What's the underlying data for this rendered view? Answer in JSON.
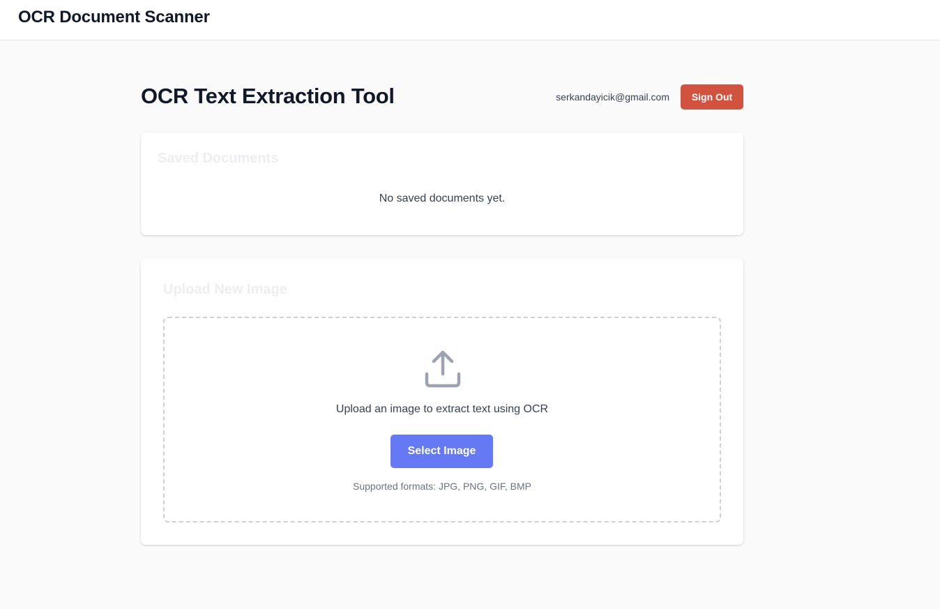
{
  "app": {
    "title": "OCR Document Scanner"
  },
  "header": {
    "title": "OCR Text Extraction Tool",
    "user_email": "serkandayicik@gmail.com",
    "sign_out_label": "Sign Out"
  },
  "saved_documents": {
    "title": "Saved Documents",
    "empty_message": "No saved documents yet."
  },
  "upload": {
    "title": "Upload New Image",
    "icon": "upload-icon",
    "prompt": "Upload an image to extract text using OCR",
    "button_label": "Select Image",
    "supported_formats": "Supported formats: JPG, PNG, GIF, BMP"
  },
  "colors": {
    "background": "#fafafa",
    "sign_out_button": "#d1533f",
    "select_button": "#6679f5",
    "icon": "#9ca3af"
  }
}
